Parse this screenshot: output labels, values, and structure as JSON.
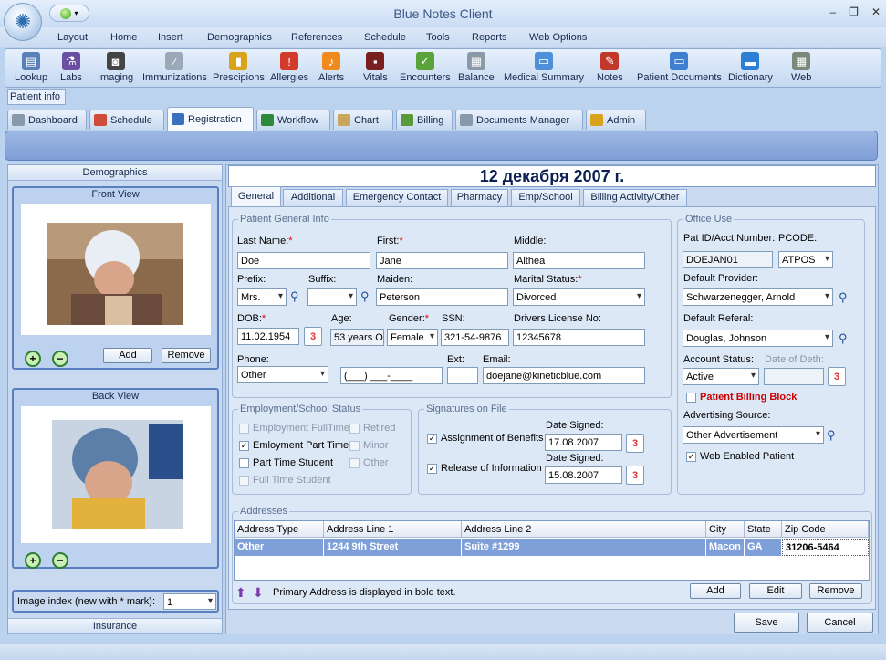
{
  "app": {
    "title": "Blue Notes Client",
    "window_controls": [
      "–",
      "❐",
      "✕"
    ]
  },
  "menu": [
    "Layout",
    "Home",
    "Insert",
    "Demographics",
    "References",
    "Schedule",
    "Tools",
    "Reports",
    "Web Options"
  ],
  "toolbar": [
    {
      "label": "Lookup",
      "icon": "lookup-icon",
      "color": "#5b7fb8"
    },
    {
      "label": "Labs",
      "icon": "labs-icon",
      "color": "#6a4fa3"
    },
    {
      "label": "Imaging",
      "icon": "imaging-icon",
      "color": "#444"
    },
    {
      "label": "Immunizations",
      "icon": "syringe-icon",
      "color": "#9aa8b8"
    },
    {
      "label": "Prescipions",
      "icon": "pill-bottle-icon",
      "color": "#d9a21b"
    },
    {
      "label": "Allergies",
      "icon": "warning-icon",
      "color": "#d23a2a"
    },
    {
      "label": "Alerts",
      "icon": "bell-icon",
      "color": "#f08a1c"
    },
    {
      "label": "Vitals",
      "icon": "vitals-monitor-icon",
      "color": "#7a1f1f"
    },
    {
      "label": "Encounters",
      "icon": "encounters-icon",
      "color": "#5aa33a"
    },
    {
      "label": "Balance",
      "icon": "calculator-icon",
      "color": "#8a9aa8"
    },
    {
      "label": "Medical Summary",
      "icon": "folder-icon",
      "color": "#4f8fd9"
    },
    {
      "label": "Notes",
      "icon": "notes-icon",
      "color": "#c0392b"
    },
    {
      "label": "Patient Documents",
      "icon": "documents-folder-icon",
      "color": "#3f7fd0"
    },
    {
      "label": "Dictionary",
      "icon": "dictionary-icon",
      "color": "#2d7fd3"
    },
    {
      "label": "Web",
      "icon": "web-icon",
      "color": "#7a8a7a"
    }
  ],
  "patient_info_label": "Patient info",
  "main_tabs": [
    {
      "label": "Dashboard",
      "icon": "dashboard-icon",
      "color": "#8899aa"
    },
    {
      "label": "Schedule",
      "icon": "schedule-icon",
      "color": "#d24a3a"
    },
    {
      "label": "Registration",
      "icon": "registration-icon",
      "color": "#3a6fc0",
      "active": true
    },
    {
      "label": "Workflow",
      "icon": "workflow-icon",
      "color": "#2d8a3a"
    },
    {
      "label": "Chart",
      "icon": "chart-icon",
      "color": "#c9a45a"
    },
    {
      "label": "Billing",
      "icon": "billing-icon",
      "color": "#5a9a3a"
    },
    {
      "label": "Documents Manager",
      "icon": "documents-manager-icon",
      "color": "#8899aa"
    },
    {
      "label": "Admin",
      "icon": "admin-icon",
      "color": "#d9a21b"
    }
  ],
  "left": {
    "demographics_header": "Demographics",
    "front_view": "Front View",
    "back_view": "Back View",
    "add_label": "Add",
    "remove_label": "Remove",
    "image_index_label": "Image index (new with * mark):",
    "image_index_value": "1",
    "insurance_header": "Insurance"
  },
  "date_header": "12 декабря 2007 г.",
  "sub_tabs": [
    "General",
    "Additional",
    "Emergency Contact",
    "Pharmacy",
    "Emp/School",
    "Billing Activity/Other"
  ],
  "general": {
    "legend": "Patient General Info",
    "last_name_label": "Last Name:",
    "last_name": "Doe",
    "first_label": "First:",
    "first": "Jane",
    "middle_label": "Middle:",
    "middle": "Althea",
    "prefix_label": "Prefix:",
    "prefix": "Mrs.",
    "suffix_label": "Suffix:",
    "suffix": "",
    "maiden_label": "Maiden:",
    "maiden": "Peterson",
    "marital_label": "Marital Status:",
    "marital": "Divorced",
    "dob_label": "DOB:",
    "dob": "11.02.1954",
    "age_label": "Age:",
    "age": "53 years O",
    "gender_label": "Gender:",
    "gender": "Female",
    "ssn_label": "SSN:",
    "ssn": "321-54-9876",
    "license_label": "Drivers License No:",
    "license": "12345678",
    "phone_label": "Phone:",
    "phone_type": "Other",
    "phone": "(___) ___-____",
    "ext_label": "Ext:",
    "ext": "",
    "email_label": "Email:",
    "email": "doejane@kineticblue.com",
    "required_mark": "*"
  },
  "office": {
    "legend": "Office Use",
    "pat_id_label": "Pat ID/Acct Number:",
    "pat_id": "DOEJAN01",
    "pcode_label": "PCODE:",
    "pcode": "ATPOS",
    "provider_label": "Default Provider:",
    "provider": "Schwarzenegger, Arnold",
    "referal_label": "Default Referal:",
    "referal": "Douglas, Johnson",
    "account_status_label": "Account Status:",
    "account_status": "Active",
    "death_label": "Date of Deth:",
    "death": "",
    "billing_block_label": "Patient Billing Block",
    "billing_block_color": "#cc0000",
    "advertising_label": "Advertising Source:",
    "advertising": "Other Advertisement",
    "web_enabled_label": "Web Enabled Patient"
  },
  "employment": {
    "legend": "Employment/School Status",
    "items": [
      {
        "label": "Employment FullTime",
        "checked": false,
        "enabled": false
      },
      {
        "label": "Emloyment Part Time",
        "checked": true,
        "enabled": true
      },
      {
        "label": "Part Time Student",
        "checked": false,
        "enabled": true
      },
      {
        "label": "Full Time Student",
        "checked": false,
        "enabled": false
      },
      {
        "label": "Retired",
        "checked": false,
        "enabled": false
      },
      {
        "label": "Minor",
        "checked": false,
        "enabled": false
      },
      {
        "label": "Other",
        "checked": false,
        "enabled": false
      }
    ]
  },
  "signatures": {
    "legend": "Signatures on File",
    "date_label": "Date Signed:",
    "assignment_label": "Assignment of Benefits",
    "assignment_date": "17.08.2007",
    "release_label": "Release of Information",
    "release_date": "15.08.2007"
  },
  "addresses": {
    "legend": "Addresses",
    "columns": [
      "Address Type",
      "Address Line 1",
      "Address Line 2",
      "City",
      "State",
      "Zip Code"
    ],
    "rows": [
      [
        "Other",
        "1244 9th Street",
        "Suite #1299",
        "Macon",
        "GA",
        "31206-5464"
      ]
    ],
    "note": "Primary Address is displayed in bold text.",
    "add_label": "Add",
    "edit_label": "Edit",
    "remove_label": "Remove"
  },
  "footer": {
    "save_label": "Save",
    "cancel_label": "Cancel"
  }
}
